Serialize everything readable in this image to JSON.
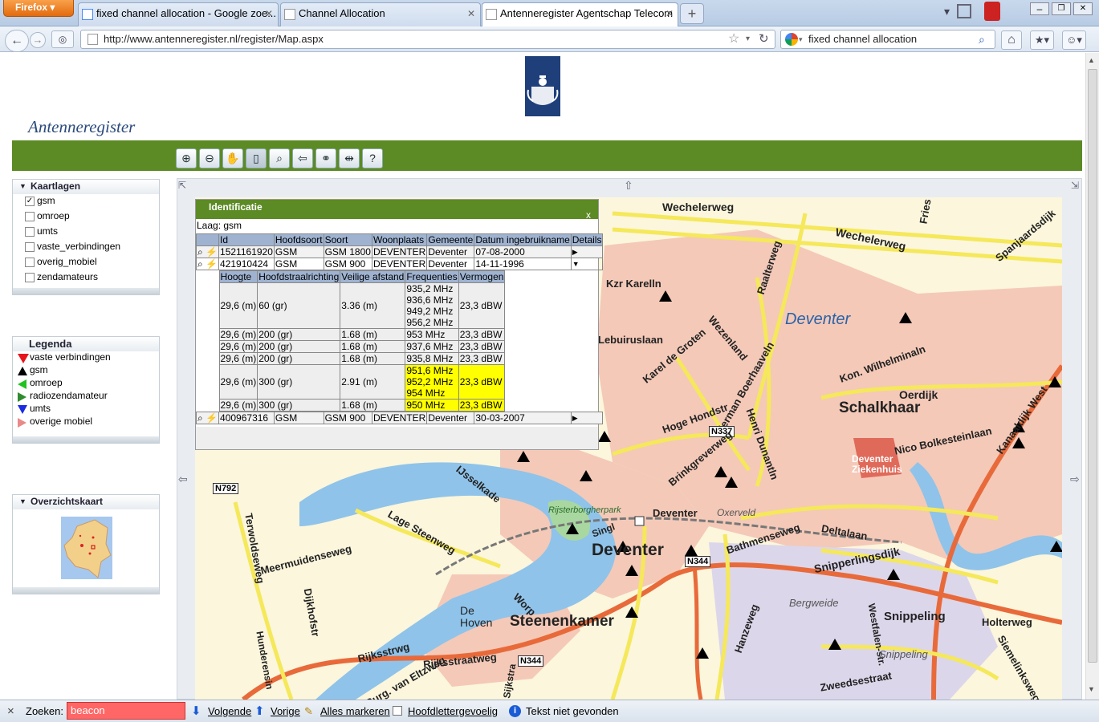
{
  "browser": {
    "menu_button": "Firefox",
    "tabs": [
      {
        "label": "fixed channel allocation - Google zoe..."
      },
      {
        "label": "Channel Allocation"
      },
      {
        "label": "Antenneregister Agentschap Telecom"
      }
    ],
    "url": "http://www.antenneregister.nl/register/Map.aspx",
    "search_value": "fixed channel allocation"
  },
  "site": {
    "title": "Antenneregister"
  },
  "layers_panel": {
    "title": "Kaartlagen",
    "items": [
      {
        "label": "gsm",
        "checked": true
      },
      {
        "label": "omroep",
        "checked": false
      },
      {
        "label": "umts",
        "checked": false
      },
      {
        "label": "vaste_verbindingen",
        "checked": false
      },
      {
        "label": "overig_mobiel",
        "checked": false
      },
      {
        "label": "zendamateurs",
        "checked": false
      }
    ]
  },
  "legend_panel": {
    "title": "Legenda",
    "items": [
      {
        "label": "vaste verbindingen",
        "color": "#e8141b",
        "shape": "triangle-down"
      },
      {
        "label": "gsm",
        "color": "#000000",
        "shape": "triangle-up"
      },
      {
        "label": "omroep",
        "color": "#22c222",
        "shape": "triangle-left"
      },
      {
        "label": "radiozendamateur",
        "color": "#2e8b2e",
        "shape": "triangle-right"
      },
      {
        "label": "umts",
        "color": "#1a2be0",
        "shape": "triangle-down"
      },
      {
        "label": "overige mobiel",
        "color": "#e88a8a",
        "shape": "triangle-right"
      }
    ]
  },
  "overview_panel": {
    "title": "Overzichtskaart"
  },
  "identify": {
    "title": "Identificatie",
    "close": "x",
    "layer_label": "Laag: gsm",
    "columns": [
      "Id",
      "Hoofdsoort",
      "Soort",
      "Woonplaats",
      "Gemeente",
      "Datum ingebruikname",
      "Details"
    ],
    "rows": [
      {
        "id": "1521161920",
        "hoofdsoort": "GSM",
        "soort": "GSM 1800",
        "woonplaats": "DEVENTER",
        "gemeente": "Deventer",
        "datum": "07-08-2000"
      },
      {
        "id": "421910424",
        "hoofdsoort": "GSM",
        "soort": "GSM 900",
        "woonplaats": "DEVENTER",
        "gemeente": "Deventer",
        "datum": "14-11-1996"
      },
      {
        "id": "400967316",
        "hoofdsoort": "GSM",
        "soort": "GSM 900",
        "woonplaats": "DEVENTER",
        "gemeente": "Deventer",
        "datum": "30-03-2007"
      }
    ],
    "detail_columns": [
      "Hoogte",
      "Hoofdstraalrichting",
      "Veilige afstand",
      "Frequenties",
      "Vermogen"
    ],
    "detail_rows": [
      {
        "hoogte": "29,6 (m)",
        "richting": "60 (gr)",
        "afstand": "3.36 (m)",
        "frequenties": [
          "935,2 MHz",
          "936,6 MHz",
          "949,2 MHz",
          "956,2 MHz"
        ],
        "vermogen": "23,3 dBW",
        "highlight": false
      },
      {
        "hoogte": "29,6 (m)",
        "richting": "200 (gr)",
        "afstand": "1.68 (m)",
        "frequenties": [
          "953 MHz"
        ],
        "vermogen": "23,3 dBW",
        "highlight": false
      },
      {
        "hoogte": "29,6 (m)",
        "richting": "200 (gr)",
        "afstand": "1.68 (m)",
        "frequenties": [
          "937,6 MHz"
        ],
        "vermogen": "23,3 dBW",
        "highlight": false
      },
      {
        "hoogte": "29,6 (m)",
        "richting": "200 (gr)",
        "afstand": "1.68 (m)",
        "frequenties": [
          "935,8 MHz"
        ],
        "vermogen": "23,3 dBW",
        "highlight": false
      },
      {
        "hoogte": "29,6 (m)",
        "richting": "300 (gr)",
        "afstand": "2.91 (m)",
        "frequenties": [
          "951,6 MHz",
          "952,2 MHz",
          "954 MHz"
        ],
        "vermogen": "23,3 dBW",
        "highlight": true
      },
      {
        "hoogte": "29,6 (m)",
        "richting": "300 (gr)",
        "afstand": "1.68 (m)",
        "frequenties": [
          "950 MHz"
        ],
        "vermogen": "23,3 dBW",
        "highlight": true
      }
    ]
  },
  "map_labels": {
    "wechelerweg": "Wechelerweg",
    "wechelerweg2": "Wechelerweg",
    "spanjaardsdijk": "Spanjaardsdijk",
    "fries": "Fries",
    "raalterweg": "Raalterweg",
    "kzr_karel": "Kzr Karelln",
    "deventer_city": "Deventer",
    "leburius": "Lebuiruslaan",
    "karel_groten": "Karel de Groten",
    "wezenland": "Wezenland",
    "kon_wilhelmina": "Kon. Wilhelminaln",
    "oerdijk": "Oerdijk",
    "schalkhaar": "Schalkhaar",
    "hoge_hondstr": "Hoge Hondstr",
    "herman_boerhaavel": "Herman Boerhaaveln",
    "n337": "N337",
    "henri_dunantln": "Henri Dunantln",
    "brinkgreverweg": "Brinkgreverweg",
    "ziekenhuis": "Deventer Ziekenhuis",
    "nico_bolkestein": "Nico Bolkesteinlaan",
    "kanaaldijk": "Kanaaldijk West",
    "n792": "N792",
    "ijsselkade": "IJsselkade",
    "rijsterborgherpark": "Rijsterborgherpark",
    "deventer_station": "Deventer",
    "oxerveld": "Oxerveld",
    "lage_steenweg": "Lage Steenweg",
    "singl": "Singl",
    "deventer_big": "Deventer",
    "bathmenseweg": "Bathmenseweg",
    "deltalaan": "Deltalaan",
    "meermuidenseweg": "Meermuidenseweg",
    "n344a": "N344",
    "snipperlingsdijk": "Snipperlingsdijk",
    "terwoldseweg": "Terwoldseweg",
    "dijkhofstr": "Dijkhofstr",
    "de_hoven": "De Hoven",
    "worp": "Worp",
    "steenenkamer": "Steenenkamer",
    "bergweide": "Bergweide",
    "hanzeweg": "Hanzeweg",
    "westfalenstr": "Westfalen-str.",
    "snippeling": "Snippeling",
    "snippeling2": "Snippeling",
    "holterweg": "Holterweg",
    "hunderensin": "Hunderensin",
    "rijksstrweg": "Rijksstrwg",
    "rijksstraatweg": "Rijksstraatweg",
    "n344b": "N344",
    "burg_van_eltzweg": "Burg. van Eltzweg",
    "zweedsestraat": "Zweedsestraat",
    "stenenkamer_dijk": "Sijkstra",
    "siemelinksweg": "Siemelinksweg"
  },
  "findbar": {
    "close": "×",
    "label": "Zoeken:",
    "value": "beacon",
    "next": "Volgende",
    "prev": "Vorige",
    "highlight_all": "Alles markeren",
    "match_case": "Hoofdlettergevoelig",
    "status": "Tekst niet gevonden"
  }
}
